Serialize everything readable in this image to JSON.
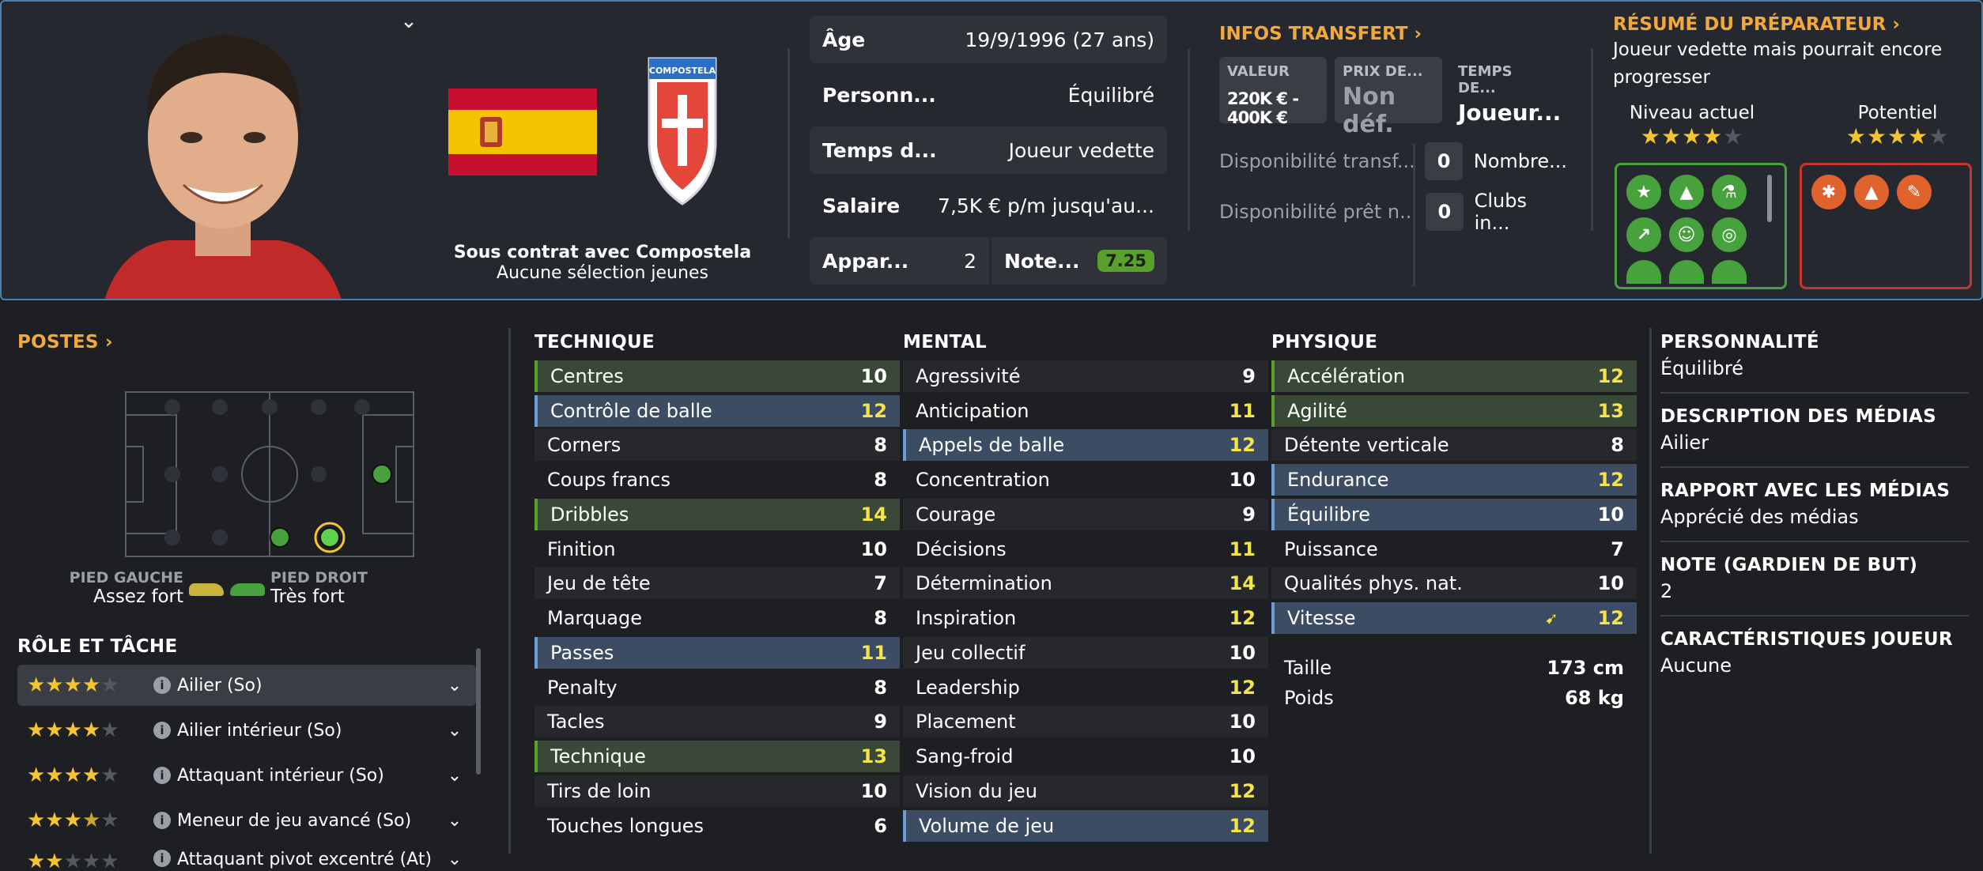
{
  "header": {
    "contract": {
      "line1": "Sous contrat avec Compostela",
      "line2": "Aucune sélection jeunes"
    },
    "club_crest_text": "COMPOSTELA",
    "info": {
      "age_label": "Âge",
      "age_value": "19/9/1996 (27 ans)",
      "personality_label": "Personn...",
      "personality_value": "Équilibré",
      "playtime_label": "Temps d...",
      "playtime_value": "Joueur vedette",
      "salary_label": "Salaire",
      "salary_value": "7,5K € p/m jusqu'au...",
      "appearances_label": "Appar...",
      "appearances_value": "2",
      "rating_label": "Note...",
      "rating_value": "7.25"
    },
    "transfer": {
      "title": "INFOS TRANSFERT",
      "value_label": "VALEUR",
      "value_value": "220K € - 400K €",
      "price_label": "PRIX DE...",
      "price_value": "Non déf.",
      "time_label": "TEMPS DE...",
      "time_value": "Joueur...",
      "transfer_avail_label": "Disponibilité transf...",
      "transfer_avail_value": "0",
      "transfer_avail_right": "Nombre...",
      "loan_avail_label": "Disponibilité prêt n...",
      "loan_avail_value": "0",
      "loan_avail_right": "Clubs in..."
    },
    "coach": {
      "title": "RÉSUMÉ DU PRÉPARATEUR",
      "summary": "Joueur vedette mais pourrait encore progresser",
      "current_label": "Niveau actuel",
      "current_stars": 4,
      "potential_label": "Potentiel",
      "potential_stars": 4
    }
  },
  "positions": {
    "title": "POSTES",
    "left_foot_label": "PIED GAUCHE",
    "left_foot_value": "Assez fort",
    "right_foot_label": "PIED DROIT",
    "right_foot_value": "Très fort",
    "role_title": "RÔLE ET TÂCHE",
    "roles": [
      {
        "name": "Ailier (So)",
        "stars": 4
      },
      {
        "name": "Ailier intérieur (So)",
        "stars": 4
      },
      {
        "name": "Attaquant intérieur (So)",
        "stars": 4
      },
      {
        "name": "Meneur de jeu avancé (So)",
        "stars": 3.5
      },
      {
        "name": "Attaquant pivot excentré (At)",
        "stars": 2
      }
    ]
  },
  "technique": {
    "title": "TECHNIQUE",
    "attrs": [
      {
        "name": "Centres",
        "value": "10"
      },
      {
        "name": "Contrôle de balle",
        "value": "12"
      },
      {
        "name": "Corners",
        "value": "8"
      },
      {
        "name": "Coups francs",
        "value": "8"
      },
      {
        "name": "Dribbles",
        "value": "14"
      },
      {
        "name": "Finition",
        "value": "10"
      },
      {
        "name": "Jeu de tête",
        "value": "7"
      },
      {
        "name": "Marquage",
        "value": "8"
      },
      {
        "name": "Passes",
        "value": "11"
      },
      {
        "name": "Penalty",
        "value": "8"
      },
      {
        "name": "Tacles",
        "value": "9"
      },
      {
        "name": "Technique",
        "value": "13"
      },
      {
        "name": "Tirs de loin",
        "value": "10"
      },
      {
        "name": "Touches longues",
        "value": "6"
      }
    ]
  },
  "mental": {
    "title": "MENTAL",
    "attrs": [
      {
        "name": "Agressivité",
        "value": "9"
      },
      {
        "name": "Anticipation",
        "value": "11"
      },
      {
        "name": "Appels de balle",
        "value": "12"
      },
      {
        "name": "Concentration",
        "value": "10"
      },
      {
        "name": "Courage",
        "value": "9"
      },
      {
        "name": "Décisions",
        "value": "11"
      },
      {
        "name": "Détermination",
        "value": "14"
      },
      {
        "name": "Inspiration",
        "value": "12"
      },
      {
        "name": "Jeu collectif",
        "value": "10"
      },
      {
        "name": "Leadership",
        "value": "12"
      },
      {
        "name": "Placement",
        "value": "10"
      },
      {
        "name": "Sang-froid",
        "value": "10"
      },
      {
        "name": "Vision du jeu",
        "value": "12"
      },
      {
        "name": "Volume de jeu",
        "value": "12"
      }
    ]
  },
  "physique": {
    "title": "PHYSIQUE",
    "attrs": [
      {
        "name": "Accélération",
        "value": "12"
      },
      {
        "name": "Agilité",
        "value": "13"
      },
      {
        "name": "Détente verticale",
        "value": "8"
      },
      {
        "name": "Endurance",
        "value": "12"
      },
      {
        "name": "Équilibre",
        "value": "10"
      },
      {
        "name": "Puissance",
        "value": "7"
      },
      {
        "name": "Qualités phys. nat.",
        "value": "10"
      },
      {
        "name": "Vitesse",
        "value": "12"
      }
    ],
    "height_label": "Taille",
    "height_value": "173 cm",
    "weight_label": "Poids",
    "weight_value": "68 kg"
  },
  "profile": {
    "personality_title": "PERSONNALITÉ",
    "personality_value": "Équilibré",
    "media_desc_title": "DESCRIPTION DES MÉDIAS",
    "media_desc_value": "Ailier",
    "media_rel_title": "RAPPORT AVEC LES MÉDIAS",
    "media_rel_value": "Apprécié des médias",
    "gk_title": "NOTE (GARDIEN DE BUT)",
    "gk_value": "2",
    "traits_title": "CARACTÉRISTIQUES JOUEUR",
    "traits_value": "Aucune"
  },
  "colors": {
    "accent": "#f2a93b",
    "highlight_value": "#f5e34a",
    "green": "#5aa02c",
    "blue_hl": "#3c4c62"
  }
}
